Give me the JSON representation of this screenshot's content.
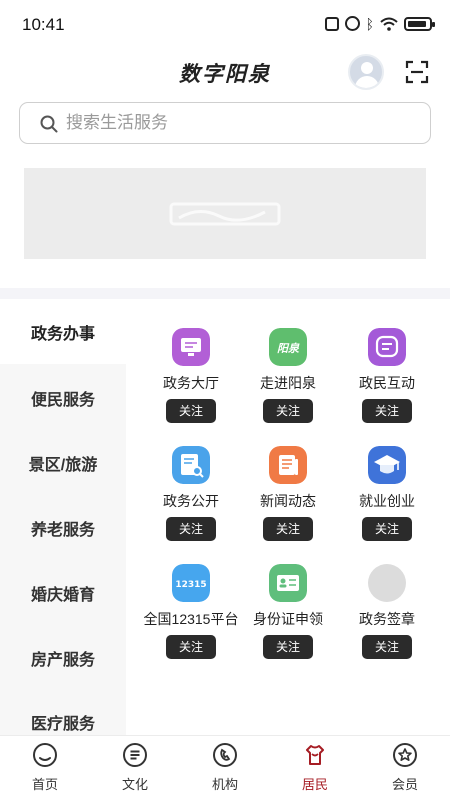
{
  "status_bar": {
    "time": "10:41"
  },
  "header": {
    "title": "数字阳泉"
  },
  "search": {
    "placeholder": "搜索生活服务"
  },
  "categories": [
    {
      "label": "政务办事",
      "active": true
    },
    {
      "label": "便民服务",
      "active": false
    },
    {
      "label": "景区/旅游",
      "active": false
    },
    {
      "label": "养老服务",
      "active": false
    },
    {
      "label": "婚庆婚育",
      "active": false
    },
    {
      "label": "房产服务",
      "active": false
    },
    {
      "label": "医疗服务",
      "active": false
    }
  ],
  "services": [
    {
      "label": "政务大厅",
      "follow": "关注",
      "icon": "monitor-icon",
      "color": "#b25fd6"
    },
    {
      "label": "走进阳泉",
      "follow": "关注",
      "icon": "yangquan-logo-icon",
      "color": "#5fbe6e",
      "icon_text": "阳泉"
    },
    {
      "label": "政民互动",
      "follow": "关注",
      "icon": "chat-icon",
      "color": "#a45ad8"
    },
    {
      "label": "政务公开",
      "follow": "关注",
      "icon": "document-search-icon",
      "color": "#4aa3ea"
    },
    {
      "label": "新闻动态",
      "follow": "关注",
      "icon": "news-icon",
      "color": "#f07a45"
    },
    {
      "label": "就业创业",
      "follow": "关注",
      "icon": "graduation-cap-icon",
      "color": "#3f73d9"
    },
    {
      "label": "全国12315平台",
      "follow": "关注",
      "icon": "badge-12315-icon",
      "color": "#46a6ee",
      "icon_text": "12315"
    },
    {
      "label": "身份证申领",
      "follow": "关注",
      "icon": "id-card-icon",
      "color": "#5fbe7c"
    },
    {
      "label": "政务签章",
      "follow": "关注",
      "icon": "placeholder-circle-icon",
      "color": "#dcdcdc"
    }
  ],
  "bottom_nav": [
    {
      "label": "首页",
      "icon": "home-icon",
      "active": false
    },
    {
      "label": "文化",
      "icon": "culture-icon",
      "active": false
    },
    {
      "label": "机构",
      "icon": "institution-icon",
      "active": false
    },
    {
      "label": "居民",
      "icon": "resident-icon",
      "active": true
    },
    {
      "label": "会员",
      "icon": "member-icon",
      "active": false
    }
  ],
  "colors": {
    "accent": "#a61d24",
    "follow_button": "#2b2b2b",
    "sidebar_bg": "#f7f7f7"
  }
}
